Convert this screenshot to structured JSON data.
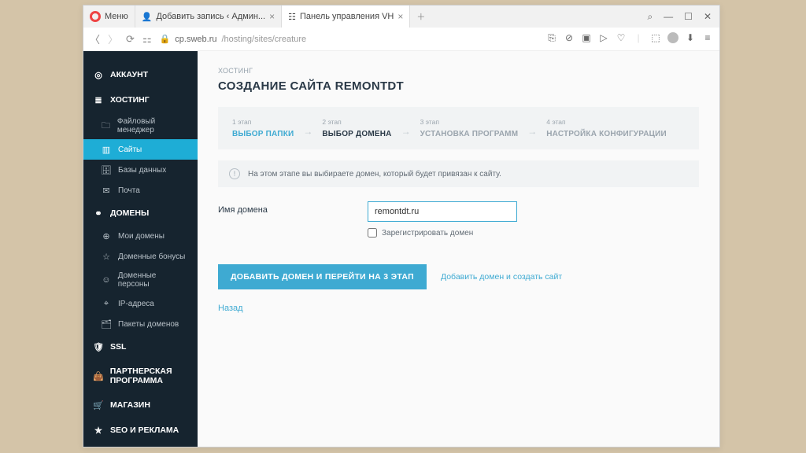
{
  "tabs": [
    {
      "label": "Меню"
    },
    {
      "label": "Добавить запись ‹ Админ..."
    },
    {
      "label": "Панель управления VH",
      "active": true
    }
  ],
  "url": {
    "host": "cp.sweb.ru",
    "path": "/hosting/sites/creature"
  },
  "sidebar": {
    "account": "АККАУНТ",
    "hosting": "ХОСТИНГ",
    "filemgr": "Файловый менеджер",
    "sites": "Сайты",
    "db": "Базы данных",
    "mail": "Почта",
    "domains": "ДОМЕНЫ",
    "mydomains": "Мои домены",
    "bonuses": "Доменные бонусы",
    "persons": "Доменные персоны",
    "ips": "IP-адреса",
    "packs": "Пакеты доменов",
    "ssl": "SSL",
    "partner": "ПАРТНЕРСКАЯ ПРОГРАММА",
    "shop": "МАГАЗИН",
    "seo": "SEO И РЕКЛАМА"
  },
  "main": {
    "crumb": "ХОСТИНГ",
    "title": "СОЗДАНИЕ САЙТА REMONTDT",
    "steps": [
      {
        "n": "1 этап",
        "name": "ВЫБОР ПАПКИ",
        "state": "done"
      },
      {
        "n": "2 этап",
        "name": "ВЫБОР ДОМЕНА",
        "state": "cur"
      },
      {
        "n": "3 этап",
        "name": "УСТАНОВКА ПРОГРАММ",
        "state": ""
      },
      {
        "n": "4 этап",
        "name": "НАСТРОЙКА КОНФИГУРАЦИИ",
        "state": ""
      }
    ],
    "hint": "На этом этапе вы выбираете домен, который будет привязан к сайту.",
    "domain_label": "Имя домена",
    "domain_value": "remontdt.ru",
    "register_chk": "Зарегистрировать домен",
    "btn_primary": "ДОБАВИТЬ ДОМЕН И ПЕРЕЙТИ НА 3 ЭТАП",
    "link_secondary": "Добавить домен и создать сайт",
    "back": "Назад"
  }
}
